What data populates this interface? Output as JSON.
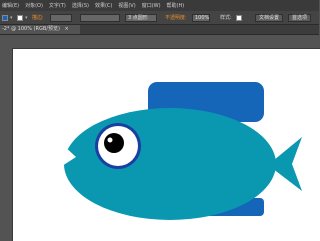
{
  "menubar": {
    "items": [
      "编辑(E)",
      "对象(O)",
      "文字(T)",
      "选择(S)",
      "效果(C)",
      "视图(V)",
      "窗口(W)",
      "帮助(H)"
    ]
  },
  "control": {
    "stroke_label": "描边:",
    "stroke_value": "",
    "brush_value": "3 点圆形",
    "opacity_label": "不透明度:",
    "opacity_value": "100%",
    "style_label": "样式:",
    "doc_setup": "文档设置",
    "prefs": "首选项"
  },
  "tab": {
    "label": "-2* @ 100% (RGB/预览)",
    "close": "×"
  },
  "colors": {
    "fish_body": "#0a98b0",
    "fin": "#1565b8",
    "eye_ring": "#1a3fa0"
  }
}
